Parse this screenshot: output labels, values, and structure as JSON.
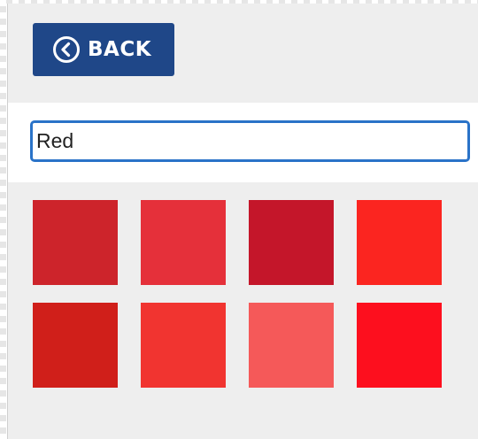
{
  "back_button": {
    "label": "BACK",
    "icon": "chevron-left-circle-icon",
    "color": "#1f4788"
  },
  "search": {
    "value": "Red",
    "border_color": "#2a73c8"
  },
  "swatches": [
    {
      "color": "#cd242b"
    },
    {
      "color": "#e5303a"
    },
    {
      "color": "#c4162a"
    },
    {
      "color": "#fb2520"
    },
    {
      "color": "#d01f1a"
    },
    {
      "color": "#f13430"
    },
    {
      "color": "#f55959"
    },
    {
      "color": "#fd0f1e"
    }
  ]
}
